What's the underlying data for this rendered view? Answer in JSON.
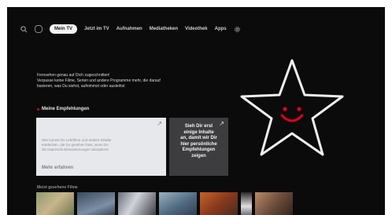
{
  "nav": {
    "items": [
      {
        "label": "Mein TV",
        "active": true
      },
      {
        "label": "Jetzt im TV"
      },
      {
        "label": "Aufnahmen"
      },
      {
        "label": "Mediatheken"
      },
      {
        "label": "Videothek"
      },
      {
        "label": "Apps"
      }
    ],
    "icons": [
      "search-icon",
      "menu-pill-icon",
      "gear-icon"
    ]
  },
  "intro": {
    "line1": "Fernsehen genau auf Dich zugeschnitten!",
    "line2": "Verpasse keine Filme, Serien und andere Programme mehr, die darauf",
    "line3": "basieren, was Du siehst, aufnimmst oder ausleihst"
  },
  "recommendations": {
    "title": "Meine Empfehlungen",
    "card1": {
      "line1": "Wer kannst Du Lehrfilme und andere Inhalte",
      "line2": "entdecken, die Du gesehen hast, wenn Du",
      "line3": "die Datenschutzbestimmungen akzeptierst",
      "more": "Mehr erfahren"
    },
    "card2": {
      "line1": "Sieh Dir erst",
      "line2": "einige Inhalte",
      "line3": "an, damit wir Dir",
      "line4": "hier persönliche",
      "line5": "Empfehlungen",
      "line6": "zeigen"
    }
  },
  "watched": {
    "title": "Meist gesehene Filme"
  },
  "colors": {
    "accent": "#e2001a",
    "background": "#0b0b0c",
    "card_light": "#e7e8ec",
    "card_dark": "#3d3d3f"
  }
}
